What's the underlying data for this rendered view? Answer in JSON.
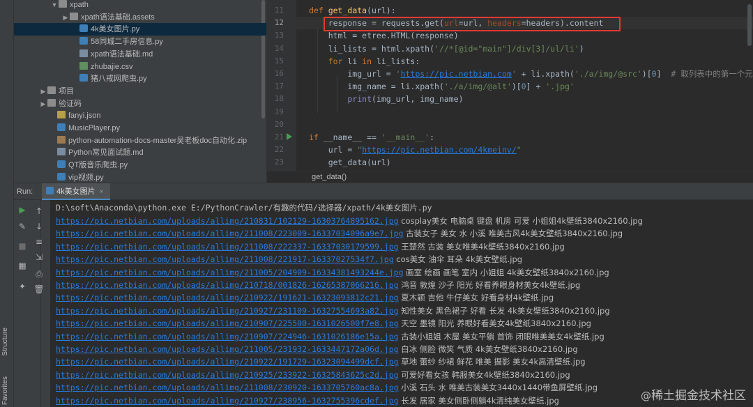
{
  "left_strip": {
    "structure_label": "Structure",
    "favorites_label": "Favorites"
  },
  "tree": {
    "items": [
      {
        "indent": 52,
        "arrow": "▼",
        "icon": "folder",
        "label": "xpath"
      },
      {
        "indent": 68,
        "arrow": "▶",
        "icon": "folder",
        "label": "xpath语法基础.assets"
      },
      {
        "indent": 82,
        "arrow": "",
        "icon": "py",
        "label": "4k美女图片.py",
        "selected": true
      },
      {
        "indent": 82,
        "arrow": "",
        "icon": "py",
        "label": "58同城二手房信息.py"
      },
      {
        "indent": 82,
        "arrow": "",
        "icon": "md",
        "label": "xpath语法基础.md"
      },
      {
        "indent": 82,
        "arrow": "",
        "icon": "csv",
        "label": "zhubajie.csv"
      },
      {
        "indent": 82,
        "arrow": "",
        "icon": "py",
        "label": "猪八戒网爬虫.py"
      },
      {
        "indent": 36,
        "arrow": "▶",
        "icon": "folder",
        "label": "项目"
      },
      {
        "indent": 36,
        "arrow": "▶",
        "icon": "folder",
        "label": "验证码"
      },
      {
        "indent": 50,
        "arrow": "",
        "icon": "json",
        "label": "fanyi.json"
      },
      {
        "indent": 50,
        "arrow": "",
        "icon": "py",
        "label": "MusicPlayer.py"
      },
      {
        "indent": 50,
        "arrow": "",
        "icon": "zip",
        "label": "python-automation-docs-master吴老板doc自动化.zip"
      },
      {
        "indent": 50,
        "arrow": "",
        "icon": "md",
        "label": "Python常见面试题.md"
      },
      {
        "indent": 50,
        "arrow": "",
        "icon": "py",
        "label": "QT版音乐爬虫.py"
      },
      {
        "indent": 50,
        "arrow": "",
        "icon": "py",
        "label": "vip视频.py"
      }
    ]
  },
  "editor": {
    "line_numbers": [
      "11",
      "12",
      "13",
      "14",
      "15",
      "16",
      "17",
      "18",
      "19",
      "20",
      "21",
      "22",
      "23"
    ],
    "active_line": "12",
    "code_lines": [
      {
        "segments": [
          {
            "c": "kw",
            "t": "def "
          },
          {
            "c": "fn",
            "t": "get_data"
          },
          {
            "c": "",
            "t": "(url):"
          }
        ]
      },
      {
        "segments": [
          {
            "c": "",
            "t": "    response = requests.get("
          },
          {
            "c": "prm",
            "t": "url"
          },
          {
            "c": "",
            "t": "=url, "
          },
          {
            "c": "prm",
            "t": "headers"
          },
          {
            "c": "",
            "t": "=headers).content"
          }
        ]
      },
      {
        "segments": [
          {
            "c": "",
            "t": "    html = etree.HTML(response)"
          }
        ]
      },
      {
        "segments": [
          {
            "c": "",
            "t": "    li_lists = html.xpath("
          },
          {
            "c": "str",
            "t": "'//*[@id=\"main\"]/div[3]/ul/li'"
          },
          {
            "c": "",
            "t": ")"
          }
        ]
      },
      {
        "segments": [
          {
            "c": "kw",
            "t": "    for "
          },
          {
            "c": "",
            "t": "li "
          },
          {
            "c": "kw",
            "t": "in "
          },
          {
            "c": "",
            "t": "li_lists:"
          }
        ]
      },
      {
        "segments": [
          {
            "c": "",
            "t": "        img_url = "
          },
          {
            "c": "str",
            "t": "'"
          },
          {
            "c": "url",
            "t": "https://pic.netbian.com"
          },
          {
            "c": "str",
            "t": "'"
          },
          {
            "c": "",
            "t": " + li.xpath("
          },
          {
            "c": "str",
            "t": "'./a/img/@src'"
          },
          {
            "c": "",
            "t": ")["
          },
          {
            "c": "num",
            "t": "0"
          },
          {
            "c": "",
            "t": "]  "
          },
          {
            "c": "cm",
            "t": "# 取列表中的第一个元素"
          }
        ]
      },
      {
        "segments": [
          {
            "c": "",
            "t": "        img_name = li.xpath("
          },
          {
            "c": "str",
            "t": "'./a/img/@alt'"
          },
          {
            "c": "",
            "t": ")["
          },
          {
            "c": "num",
            "t": "0"
          },
          {
            "c": "",
            "t": "] + "
          },
          {
            "c": "str",
            "t": "'.jpg'"
          }
        ]
      },
      {
        "segments": [
          {
            "c": "bi",
            "t": "        print"
          },
          {
            "c": "",
            "t": "(img_url, img_name)"
          }
        ]
      },
      {
        "segments": []
      },
      {
        "segments": []
      },
      {
        "segments": [
          {
            "c": "kw",
            "t": "if "
          },
          {
            "c": "",
            "t": "__name__ == "
          },
          {
            "c": "str",
            "t": "'__main__'"
          },
          {
            "c": "",
            "t": ":"
          }
        ]
      },
      {
        "segments": [
          {
            "c": "",
            "t": "    url = "
          },
          {
            "c": "str",
            "t": "\""
          },
          {
            "c": "url",
            "t": "https://pic.netbian.com/4kmeinv/"
          },
          {
            "c": "str",
            "t": "\""
          }
        ]
      },
      {
        "segments": [
          {
            "c": "",
            "t": "    get_data(url)"
          }
        ]
      }
    ],
    "breadcrumb": "get_data()"
  },
  "run": {
    "label": "Run:",
    "tab_label": "4k美女图片",
    "tab_close": "×",
    "command": "D:\\soft\\Anaconda\\python.exe E:/PythonCrawler/有趣的代码/选择器/xpath/4k美女图片.py",
    "output": [
      {
        "link": "https://pic.netbian.com/uploads/allimg/210831/102129-16303764895162.jpg",
        "desc": " cosplay美女 电脑桌 键盘 机房 可爱 小姐姐4k壁纸3840x2160.jpg"
      },
      {
        "link": "https://pic.netbian.com/uploads/allimg/211008/223009-16337034096a9e7.jpg",
        "desc": " 古装女子 美女 水 小溪 唯美古风4k美女壁纸3840x2160.jpg"
      },
      {
        "link": "https://pic.netbian.com/uploads/allimg/211008/222337-16337030179599.jpg",
        "desc": " 王楚然 古装 美女唯美4k壁纸3840x2160.jpg"
      },
      {
        "link": "https://pic.netbian.com/uploads/allimg/211008/221917-16337027534f7.jpg",
        "desc": " cos美女 油伞 耳朵 4k美女壁纸.jpg"
      },
      {
        "link": "https://pic.netbian.com/uploads/allimg/211005/204909-16334381493244e.jpg",
        "desc": " 画室 绘画 画笔 室内 小姐姐 4k美女壁纸3840x2160.jpg"
      },
      {
        "link": "https://pic.netbian.com/uploads/allimg/210718/001826-16265387066216.jpg",
        "desc": " 鸿音 敦煌 沙子 阳光 好看养眼身材美女4k壁纸.jpg"
      },
      {
        "link": "https://pic.netbian.com/uploads/allimg/210922/191621-16323093812c21.jpg",
        "desc": " 夏木颖 吉他 牛仔美女 好看身材4k壁纸.jpg"
      },
      {
        "link": "https://pic.netbian.com/uploads/allimg/210927/231109-16327554693a82.jpg",
        "desc": " 知性美女 黑色裙子 好看 长发 4k美女壁纸3840x2160.jpg"
      },
      {
        "link": "https://pic.netbian.com/uploads/allimg/210907/225500-1631026500f7e8.jpg",
        "desc": " 天空 墨镜 阳光 养眼好看美女4k壁纸3840x2160.jpg"
      },
      {
        "link": "https://pic.netbian.com/uploads/allimg/210907/224946-1631026186e15a.jpg",
        "desc": " 古装小姐姐 木屋 美女平躺 首饰 闭眼唯美美女4k壁纸.jpg"
      },
      {
        "link": "https://pic.netbian.com/uploads/allimg/211005/231932-1633447172a06d.jpg",
        "desc": " 白冰 侧脸 微笑 气质 4k美女壁纸3840x2160.jpg"
      },
      {
        "link": "https://pic.netbian.com/uploads/allimg/210922/191729-16323094499dcf.jpg",
        "desc": " 草地 蕾纱 纱裙 鲜花 唯美 摄影 美女4k高清壁纸.jpg"
      },
      {
        "link": "https://pic.netbian.com/uploads/allimg/210925/233922-16325843625c2d.jpg",
        "desc": " 可爱好看女孩 韩服美女4k壁纸3840x2160.jpg"
      },
      {
        "link": "https://pic.netbian.com/uploads/allimg/211008/230920-1633705760ac8a.jpg",
        "desc": " 小溪 石头 水 唯美古装美女3440x1440带鱼屏壁纸.jpg"
      },
      {
        "link": "https://pic.netbian.com/uploads/allimg/210927/238956-1632755396cdef.jpg",
        "desc": " 长发 居家 美女侧卧侧躺4k清纯美女壁纸.jpg"
      }
    ]
  },
  "watermark": {
    "at": "@",
    "text": "稀土掘金技术社区"
  }
}
